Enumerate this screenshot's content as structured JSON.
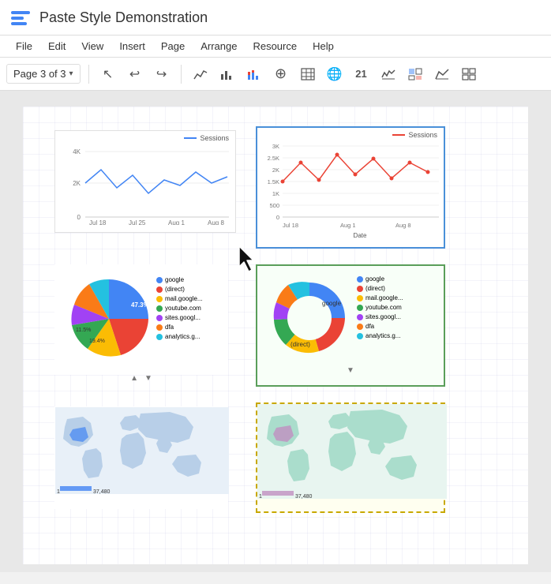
{
  "app": {
    "title": "Paste Style Demonstration",
    "logo_color": "#4285f4"
  },
  "menu": {
    "items": [
      "File",
      "Edit",
      "View",
      "Insert",
      "Page",
      "Arrange",
      "Resource",
      "Help"
    ]
  },
  "toolbar": {
    "page_label": "Page 3 of 3",
    "tools": [
      {
        "name": "select",
        "icon": "↖"
      },
      {
        "name": "undo",
        "icon": "↩"
      },
      {
        "name": "redo",
        "icon": "↪"
      },
      {
        "name": "line-chart",
        "icon": "📈"
      },
      {
        "name": "bar-chart",
        "icon": "📊"
      },
      {
        "name": "stacked-chart",
        "icon": "≡"
      },
      {
        "name": "add-chart",
        "icon": "⊕"
      },
      {
        "name": "table",
        "icon": "⊞"
      },
      {
        "name": "globe",
        "icon": "🌐"
      },
      {
        "name": "number",
        "icon": "②"
      },
      {
        "name": "sparkline",
        "icon": "⌇"
      },
      {
        "name": "pivot",
        "icon": "⊕"
      },
      {
        "name": "area-chart",
        "icon": "▲"
      },
      {
        "name": "more",
        "icon": "⊞"
      }
    ]
  },
  "charts": {
    "line_blue": {
      "title": "Sessions",
      "legend_color": "#4285f4",
      "y_labels": [
        "4K",
        "2K",
        "0"
      ],
      "x_labels": [
        "Jul 18",
        "Jul 25",
        "Aug 1",
        "Aug 8"
      ]
    },
    "line_red": {
      "title": "Sessions",
      "legend_color": "#ea4335",
      "y_labels": [
        "3K",
        "2.5K",
        "2K",
        "1.5K",
        "1K",
        "500",
        "0"
      ],
      "x_labels": [
        "Jul 18",
        "Aug 1",
        "Aug 8"
      ],
      "x_title": "Date"
    },
    "pie_left": {
      "segments": [
        {
          "label": "google",
          "color": "#4285f4",
          "pct": "47.3%"
        },
        {
          "label": "(direct)",
          "color": "#ea4335"
        },
        {
          "label": "mail.google...",
          "color": "#fbbc04"
        },
        {
          "label": "youtube.com",
          "color": "#34a853"
        },
        {
          "label": "sites.googl...",
          "color": "#a142f4"
        },
        {
          "label": "dfa",
          "color": "#fa7b17"
        },
        {
          "label": "analytics.g...",
          "color": "#24c1e0"
        }
      ],
      "labels_on_chart": [
        "47.3%",
        "19.4%",
        "11.5%"
      ]
    },
    "pie_right": {
      "segments": [
        {
          "label": "google",
          "color": "#4285f4"
        },
        {
          "label": "(direct)",
          "color": "#ea4335"
        },
        {
          "label": "mail.google...",
          "color": "#fbbc04"
        },
        {
          "label": "youtube.com",
          "color": "#34a853"
        },
        {
          "label": "sites.googl...",
          "color": "#a142f4"
        },
        {
          "label": "dfa",
          "color": "#fa7b17"
        },
        {
          "label": "analytics.g...",
          "color": "#24c1e0"
        }
      ],
      "center_labels": [
        "google",
        "(direct)"
      ]
    },
    "map_left": {
      "scale_start": "1",
      "scale_end": "37,480"
    },
    "map_right": {
      "scale_start": "1",
      "scale_end": "37,480"
    }
  }
}
